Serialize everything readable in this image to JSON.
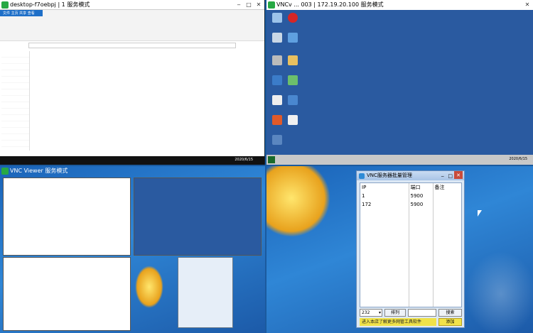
{
  "q1": {
    "title": "desktop-f7oebpj | 1",
    "mode": "服务模式",
    "ribbon": "文件 主页 共享 查看",
    "footer_time": "2020/6/15"
  },
  "q2": {
    "title": "VNCv ... 003 | 172.19.20.100",
    "mode": "服务模式",
    "task_time": "2020/6/15"
  },
  "q3": {
    "title": "VNC Viewer",
    "mode": "服务模式"
  },
  "vnc": {
    "title": "VNC服务器批量管理",
    "headers": [
      "IP",
      "端口",
      "备注"
    ],
    "rows": [
      {
        "ip": "1",
        "port": "5900",
        "note": ""
      },
      {
        "ip": "172",
        "port": "5900",
        "note": ""
      }
    ],
    "select_value": "232",
    "sort_label": "排列",
    "search_label": "搜索",
    "promo": "进入本店了解更多网管工具软件",
    "add_label": "添加"
  }
}
